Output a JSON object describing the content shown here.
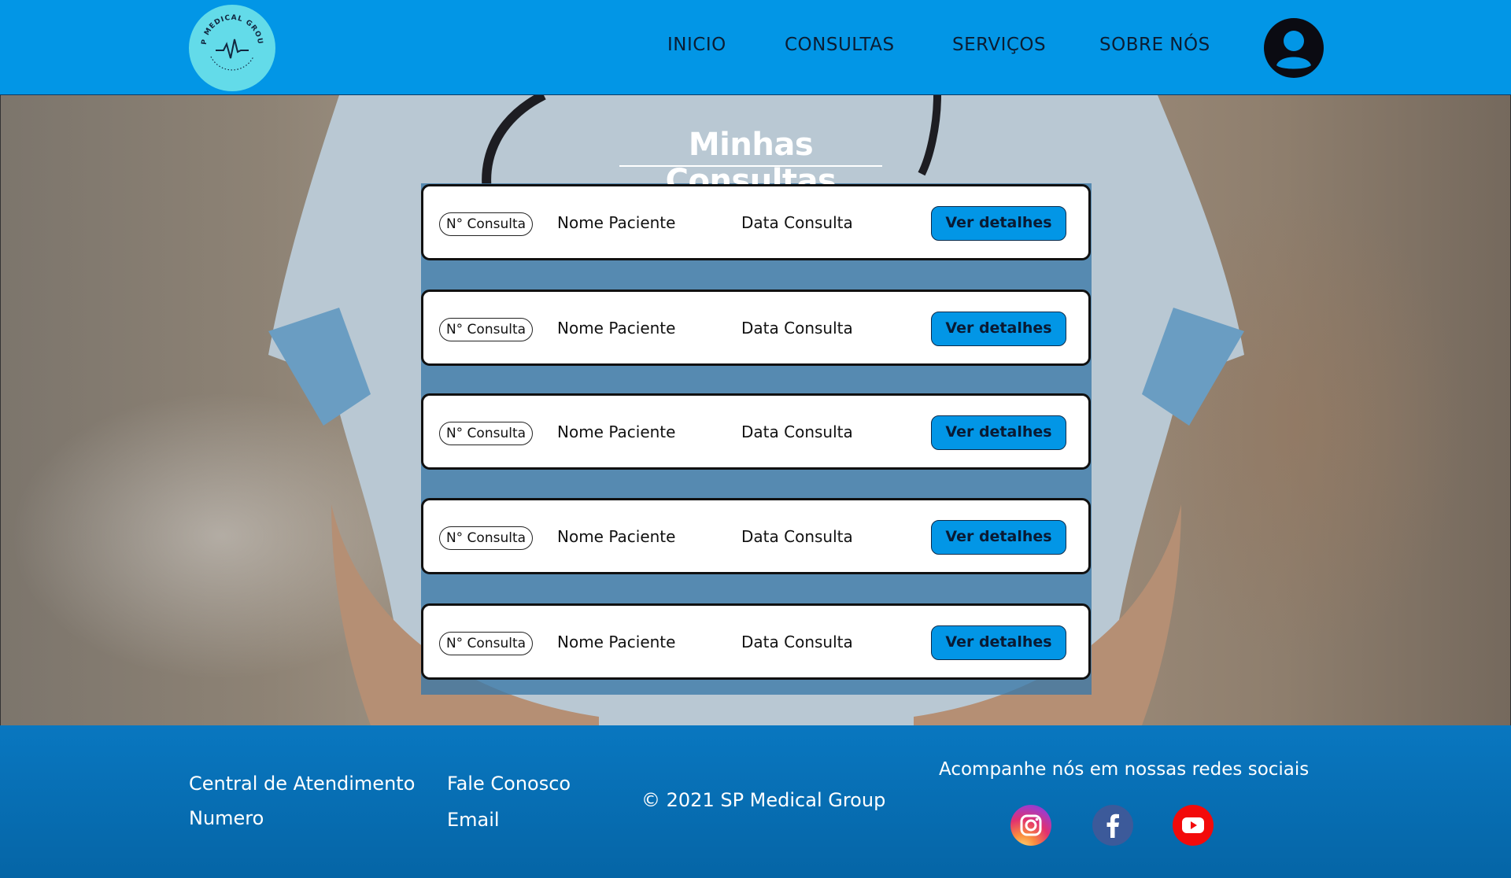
{
  "header": {
    "logo_text": "SP MEDICAL GROUP",
    "nav": [
      "INICIO",
      "CONSULTAS",
      "SERVIÇOS",
      "SOBRE NÓS"
    ],
    "user_icon": "user-circle-icon"
  },
  "main": {
    "title": "Minhas Consultas",
    "rows": [
      {
        "number": "N° Consulta",
        "patient": "Nome Paciente",
        "date": "Data Consulta",
        "button": "Ver detalhes"
      },
      {
        "number": "N° Consulta",
        "patient": "Nome Paciente",
        "date": "Data Consulta",
        "button": "Ver detalhes"
      },
      {
        "number": "N° Consulta",
        "patient": "Nome Paciente",
        "date": "Data Consulta",
        "button": "Ver detalhes"
      },
      {
        "number": "N° Consulta",
        "patient": "Nome Paciente",
        "date": "Data Consulta",
        "button": "Ver detalhes"
      },
      {
        "number": "N° Consulta",
        "patient": "Nome Paciente",
        "date": "Data Consulta",
        "button": "Ver detalhes"
      }
    ]
  },
  "footer": {
    "central": "Central de Atendimento",
    "numero": "Numero",
    "fale": "Fale Conosco",
    "email": "Email",
    "copyright": "© 2021 SP Medical Group",
    "social_title": "Acompanhe nós em nossas redes sociais",
    "social_icons": [
      "instagram-icon",
      "facebook-icon",
      "youtube-icon"
    ]
  },
  "colors": {
    "header_bg": "#0296e6",
    "button_bg": "#0296e6",
    "footer_bg": "#0672b8",
    "logo_bg": "#63dbe9"
  }
}
